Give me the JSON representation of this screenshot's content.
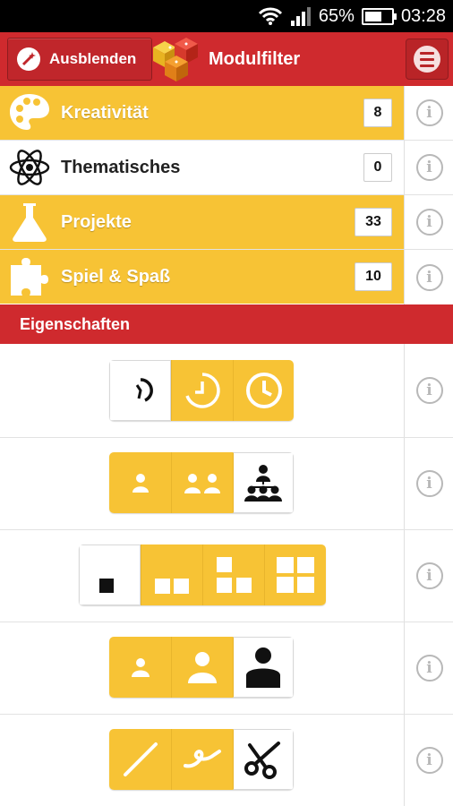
{
  "status_bar": {
    "battery": "65%",
    "time": "03:28",
    "battery_level": 0.65
  },
  "header": {
    "hide_label": "Ausblenden",
    "title": "Modulfilter"
  },
  "categories": [
    {
      "name": "Kreativität",
      "count": "8",
      "selected": true,
      "icon": "palette-icon"
    },
    {
      "name": "Thematisches",
      "count": "0",
      "selected": false,
      "icon": "atom-icon"
    },
    {
      "name": "Projekte",
      "count": "33",
      "selected": true,
      "icon": "flask-icon"
    },
    {
      "name": "Spiel & Spaß",
      "count": "10",
      "selected": true,
      "icon": "puzzle-icon"
    }
  ],
  "section": {
    "label": "Eigenschaften"
  },
  "properties": [
    {
      "name": "duration",
      "options": [
        {
          "icon": "clock-short-icon",
          "on": false
        },
        {
          "icon": "clock-medium-icon",
          "on": true
        },
        {
          "icon": "clock-long-icon",
          "on": true
        }
      ]
    },
    {
      "name": "group-size",
      "options": [
        {
          "icon": "single-person-icon",
          "on": true
        },
        {
          "icon": "pair-icon",
          "on": true
        },
        {
          "icon": "group-icon",
          "on": false
        }
      ]
    },
    {
      "name": "space",
      "options": [
        {
          "icon": "one-square-icon",
          "on": false
        },
        {
          "icon": "two-squares-icon",
          "on": true
        },
        {
          "icon": "four-squares-icon",
          "on": true
        },
        {
          "icon": "six-squares-icon",
          "on": true
        }
      ]
    },
    {
      "name": "age",
      "options": [
        {
          "icon": "small-person-icon",
          "on": true
        },
        {
          "icon": "medium-person-icon",
          "on": true
        },
        {
          "icon": "large-person-icon",
          "on": false
        }
      ]
    },
    {
      "name": "materials",
      "options": [
        {
          "icon": "pencil-icon",
          "on": true
        },
        {
          "icon": "ribbon-icon",
          "on": true
        },
        {
          "icon": "scissors-icon",
          "on": false
        }
      ]
    }
  ],
  "colors": {
    "red": "#cf2a2e",
    "yellow": "#f7c335",
    "info_gray": "#b8b8b8"
  }
}
